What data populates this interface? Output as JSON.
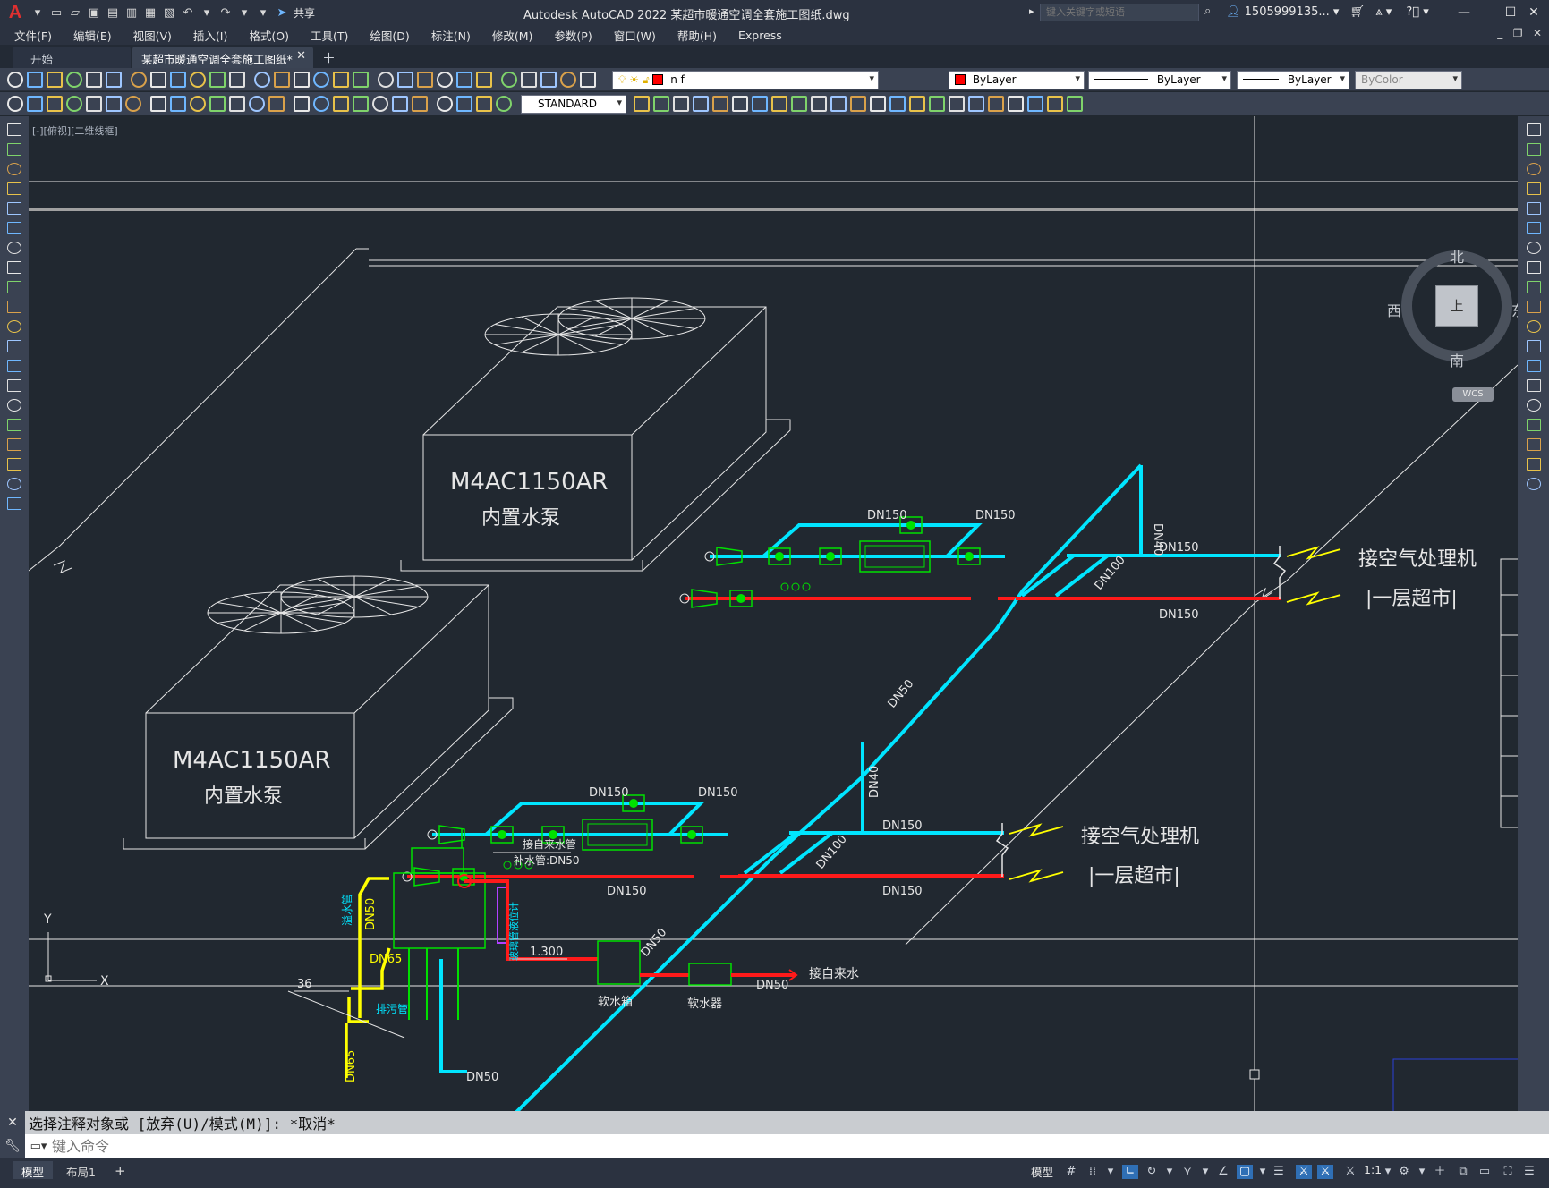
{
  "app": {
    "logo": "A",
    "title": "Autodesk AutoCAD 2022    某超市暖通空调全套施工图纸.dwg"
  },
  "search": {
    "placeholder": "键入关键字或短语"
  },
  "user": {
    "name": "1505999135..."
  },
  "menu": {
    "items": [
      "文件(F)",
      "编辑(E)",
      "视图(V)",
      "插入(I)",
      "格式(O)",
      "工具(T)",
      "绘图(D)",
      "标注(N)",
      "修改(M)",
      "参数(P)",
      "窗口(W)",
      "帮助(H)",
      "Express"
    ]
  },
  "quick_access": {
    "share_label": "共享"
  },
  "tabs": {
    "start": "开始",
    "drawing": "某超市暖通空调全套施工图纸*"
  },
  "properties": {
    "layer": "n f",
    "color": "ByLayer",
    "linetype": "ByLayer",
    "lineweight": "ByLayer",
    "plotstyle": "ByColor",
    "text_style": "STANDARD",
    "layer_color": "#ff0000"
  },
  "viewport": {
    "label": "[-][俯视][二维线框]"
  },
  "viewcube": {
    "north": "北",
    "south": "南",
    "east": "东",
    "west": "西",
    "face": "上",
    "wcs": "WCS"
  },
  "drawing": {
    "unit_label": "M4AC1150AR",
    "pump_label": "内置水泵",
    "dn150": "DN150",
    "dn100": "DN100",
    "dn50": "DN50",
    "dn40": "DN40",
    "dn65": "DN65",
    "ahu_label": "接空气处理机",
    "floor_label": "|一层超市|",
    "make_up_water": "接自来水管",
    "make_up_dn": "补水管:DN50",
    "tag_36": "36",
    "elev_1300": "1.300",
    "overflow": "溢水管",
    "drain": "排污管",
    "level_gauge": "玻璃管液位计",
    "water_tank": "软水箱",
    "softener": "软水器",
    "from_tap": "接自来水",
    "axis_x": "X",
    "axis_y": "Y",
    "colors": {
      "background": "#212830",
      "supply": "#00e5ff",
      "return": "#ff1a1a",
      "equipment": "#00e000",
      "outline": "#e6e6e6",
      "yellow": "#ffff00",
      "dim": "#ffff66"
    }
  },
  "command": {
    "history": "选择注释对象或 [放弃(U)/模式(M)]: *取消*",
    "placeholder": "键入命令"
  },
  "status": {
    "model_tab": "模型",
    "layout1_tab": "布局1",
    "add_tab": "+",
    "model_label": "模型",
    "scale": "1:1"
  }
}
